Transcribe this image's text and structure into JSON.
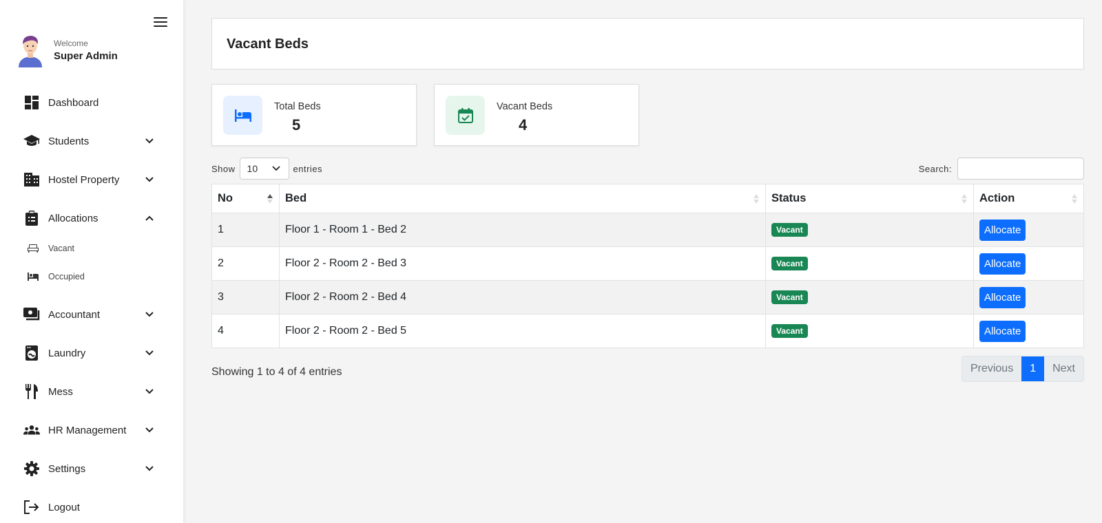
{
  "sidebar": {
    "welcome": "Welcome",
    "user_name": "Super Admin",
    "items": [
      {
        "label": "Dashboard",
        "icon": "dashboard-icon"
      },
      {
        "label": "Students",
        "icon": "graduation-cap-icon"
      },
      {
        "label": "Hostel Property",
        "icon": "building-icon"
      },
      {
        "label": "Allocations",
        "icon": "clipboard-icon"
      },
      {
        "label": "Accountant",
        "icon": "money-icon"
      },
      {
        "label": "Laundry",
        "icon": "washing-machine-icon"
      },
      {
        "label": "Mess",
        "icon": "utensils-icon"
      },
      {
        "label": "HR Management",
        "icon": "users-icon"
      },
      {
        "label": "Settings",
        "icon": "gear-icon"
      },
      {
        "label": "Logout",
        "icon": "logout-icon"
      }
    ],
    "sub_items": [
      {
        "label": "Vacant",
        "icon": "bed-outline-icon"
      },
      {
        "label": "Occupied",
        "icon": "bed-icon"
      }
    ]
  },
  "page": {
    "title": "Vacant Beds"
  },
  "stats": [
    {
      "label": "Total Beds",
      "value": "5",
      "icon": "bed-icon",
      "bg": "#e7f0ff",
      "fg": "#0d6efd"
    },
    {
      "label": "Vacant Beds",
      "value": "4",
      "icon": "calendar-check-icon",
      "bg": "#e6f6ec",
      "fg": "#198754"
    }
  ],
  "table_controls": {
    "show_label": "Show",
    "page_size": "10",
    "entries_label": "entries",
    "search_label": "Search:",
    "search_value": ""
  },
  "table": {
    "headers": [
      "No",
      "Bed",
      "Status",
      "Action"
    ],
    "rows": [
      {
        "no": "1",
        "bed": "Floor 1 - Room 1 - Bed 2",
        "status": "Vacant",
        "action": "Allocate"
      },
      {
        "no": "2",
        "bed": "Floor 2 - Room 2 - Bed 3",
        "status": "Vacant",
        "action": "Allocate"
      },
      {
        "no": "3",
        "bed": "Floor 2 - Room 2 - Bed 4",
        "status": "Vacant",
        "action": "Allocate"
      },
      {
        "no": "4",
        "bed": "Floor 2 - Room 2 - Bed 5",
        "status": "Vacant",
        "action": "Allocate"
      }
    ]
  },
  "footer": {
    "info": "Showing 1 to 4 of 4 entries",
    "previous": "Previous",
    "current_page": "1",
    "next": "Next"
  },
  "colors": {
    "primary": "#0d6efd",
    "success": "#198754"
  }
}
